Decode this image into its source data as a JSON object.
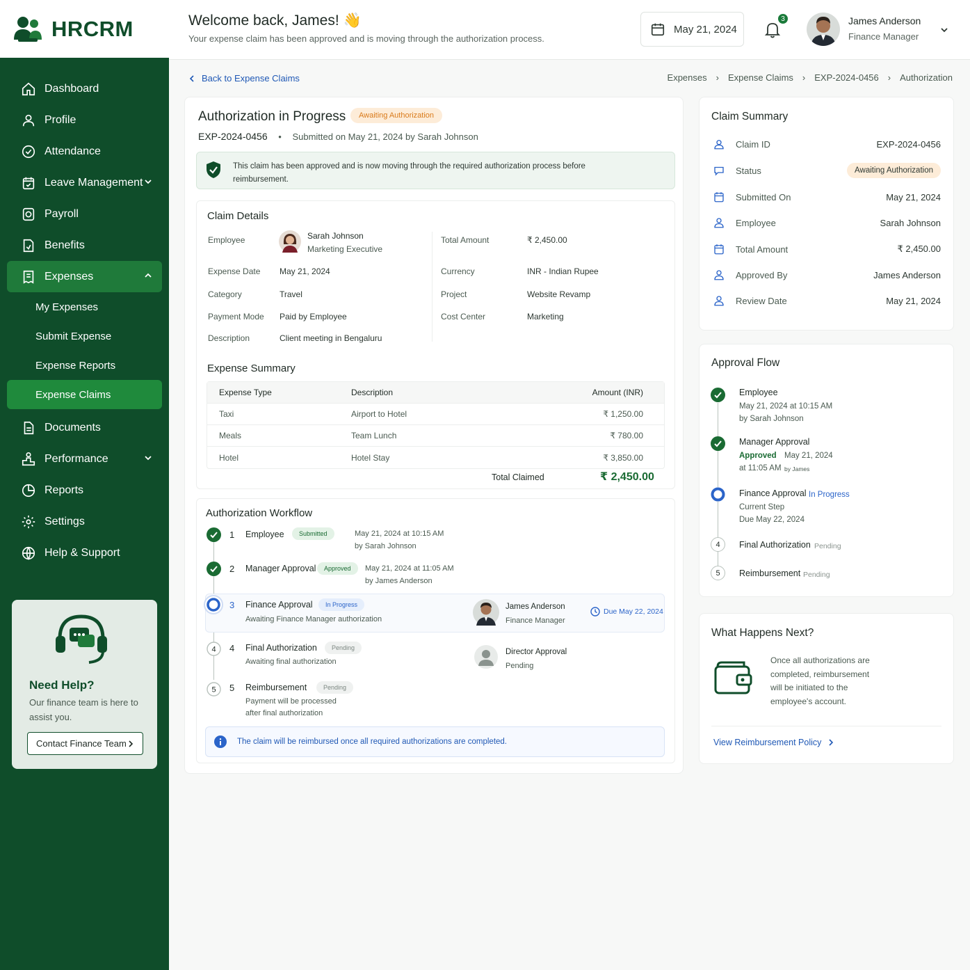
{
  "brand": {
    "name": "HRCRM"
  },
  "nav": {
    "dashboard": "Dashboard",
    "profile": "Profile",
    "attendance": "Attendance",
    "leave": "Leave Management",
    "payroll": "Payroll",
    "benefits": "Benefits",
    "expenses": "Expenses",
    "my_expenses": "My Expenses",
    "submit_expense": "Submit Expense",
    "expense_reports": "Expense Reports",
    "expense_claims": "Expense Claims",
    "documents": "Documents",
    "performance": "Performance",
    "reports": "Reports",
    "settings": "Settings",
    "help": "Help & Support"
  },
  "help_card": {
    "title": "Need Help?",
    "text": "Our finance team is here to assist you.",
    "button": "Contact Finance Team"
  },
  "header": {
    "welcome": "Welcome back, James! 👋",
    "subtitle": "Your expense claim has been approved and is moving through the authorization process.",
    "date": "May 21, 2024",
    "notification_count": "3",
    "user_name": "James Anderson",
    "user_role": "Finance Manager"
  },
  "breadcrumb": {
    "back": "Back to Expense Claims",
    "items": [
      "Expenses",
      "Expense Claims",
      "EXP-2024-0456",
      "Authorization"
    ]
  },
  "claim": {
    "title": "Authorization in Progress",
    "status": "Awaiting Authorization",
    "id": "EXP-2024-0456",
    "submitted": "Submitted on May 21, 2024 by Sarah Johnson",
    "alert": "This claim has been approved and is now moving through the required authorization process before reimbursement."
  },
  "details": {
    "title": "Claim Details",
    "employee_label": "Employee",
    "employee_name": "Sarah Johnson",
    "employee_role": "Marketing Executive",
    "expense_date_label": "Expense Date",
    "expense_date": "May 21, 2024",
    "category_label": "Category",
    "category": "Travel",
    "payment_mode_label": "Payment Mode",
    "payment_mode": "Paid by Employee",
    "description_label": "Description",
    "description": "Client meeting in Bengaluru",
    "total_label": "Total Amount",
    "total": "₹ 2,450.00",
    "currency_label": "Currency",
    "currency": "INR - Indian Rupee",
    "project_label": "Project",
    "project": "Website Revamp",
    "cost_center_label": "Cost Center",
    "cost_center": "Marketing"
  },
  "summary": {
    "title": "Expense Summary",
    "headers": [
      "Expense Type",
      "Description",
      "Amount (INR)"
    ],
    "rows": [
      [
        "Taxi",
        "Airport to Hotel",
        "₹ 1,250.00"
      ],
      [
        "Meals",
        "Team Lunch",
        "₹ 780.00"
      ],
      [
        "Hotel",
        "Hotel Stay",
        "₹ 3,850.00"
      ]
    ],
    "total_label": "Total Claimed",
    "total": "₹ 2,450.00"
  },
  "workflow": {
    "title": "Authorization Workflow",
    "steps": [
      {
        "num": "1",
        "name": "Employee",
        "status": "Submitted",
        "meta1": "May 21, 2024 at 10:15 AM",
        "meta2": "by Sarah Johnson"
      },
      {
        "num": "2",
        "name": "Manager Approval",
        "status": "Approved",
        "meta1": "May 21, 2024 at 11:05 AM",
        "meta2": "by James Anderson"
      },
      {
        "num": "3",
        "name": "Finance Approval",
        "status": "In Progress",
        "meta1": "Awaiting Finance Manager authorization",
        "assignee": "James Anderson",
        "assignee_role": "Finance Manager",
        "due": "Due May 22, 2024"
      },
      {
        "num": "4",
        "name": "Final Authorization",
        "status": "Pending",
        "meta1": "Awaiting final authorization",
        "assignee": "Director Approval",
        "assignee_role": "Pending"
      },
      {
        "num": "5",
        "name": "Reimbursement",
        "status": "Pending",
        "meta1": "Payment will be processed",
        "meta2": "after final authorization"
      }
    ],
    "info": "The claim will be reimbursed once all required authorizations are completed."
  },
  "claim_summary": {
    "title": "Claim Summary",
    "rows": [
      {
        "label": "Claim ID",
        "value": "EXP-2024-0456"
      },
      {
        "label": "Status",
        "value": "Awaiting Authorization"
      },
      {
        "label": "Submitted On",
        "value": "May 21, 2024"
      },
      {
        "label": "Employee",
        "value": "Sarah Johnson"
      },
      {
        "label": "Total Amount",
        "value": "₹ 2,450.00"
      },
      {
        "label": "Approved By",
        "value": "James Anderson"
      },
      {
        "label": "Review Date",
        "value": "May 21, 2024"
      }
    ]
  },
  "approval_flow": {
    "title": "Approval Flow",
    "employee": "Employee",
    "employee_meta1": "May 21, 2024 at 10:15 AM",
    "employee_meta2": "by Sarah Johnson",
    "manager": "Manager Approval",
    "manager_status": "Approved",
    "manager_date": "May 21, 2024",
    "manager_time": "at 11:05 AM",
    "manager_by": "by James",
    "finance": "Finance Approval",
    "finance_status": "In Progress",
    "finance_meta1": "Current Step",
    "finance_meta2": "Due May 22, 2024",
    "final_num": "4",
    "final": "Final Authorization",
    "final_status": "Pending",
    "reimb_num": "5",
    "reimb": "Reimbursement",
    "reimb_status": "Pending"
  },
  "next": {
    "title": "What Happens Next?",
    "text": "Once all authorizations are completed, reimbursement will be initiated to the employee's account.",
    "link": "View Reimbursement Policy"
  },
  "colors": {
    "brand": "#0f4d2a",
    "accent": "#1f7a3a",
    "link": "#1f58b5",
    "amber": "#d97a1a"
  }
}
